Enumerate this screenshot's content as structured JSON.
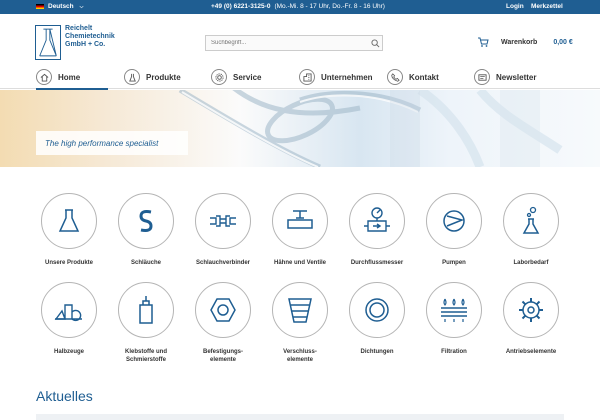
{
  "topbar": {
    "language": "Deutsch",
    "phone": "+49 (0) 6221-3125-0",
    "hours": "(Mo.-Mi. 8 - 17 Uhr, Do.-Fr. 8 - 16 Uhr)",
    "login": "Login",
    "memo": "Merkzettel"
  },
  "logo": {
    "line1": "Reichelt",
    "line2": "Chemietechnik",
    "line3": "GmbH + Co."
  },
  "search": {
    "placeholder": "Suchbegriff..."
  },
  "cart": {
    "label": "Warenkorb",
    "total": "0,00 €"
  },
  "nav": {
    "home": "Home",
    "products": "Produkte",
    "service": "Service",
    "company": "Unternehmen",
    "contact": "Kontakt",
    "newsletter": "Newsletter"
  },
  "hero": {
    "tagline": "The high performance specialist"
  },
  "categories": [
    {
      "label": "Unsere Produkte"
    },
    {
      "label": "Schläuche"
    },
    {
      "label": "Schlauchverbinder"
    },
    {
      "label": "Hähne und Ventile"
    },
    {
      "label": "Durchflussmesser"
    },
    {
      "label": "Pumpen"
    },
    {
      "label": "Laborbedarf"
    },
    {
      "label": "Halbzeuge"
    },
    {
      "line1": "Klebstoffe und",
      "line2": "Schmierstoffe"
    },
    {
      "line1": "Befestigungs-",
      "line2": "elemente"
    },
    {
      "line1": "Verschluss-",
      "line2": "elemente"
    },
    {
      "label": "Dichtungen"
    },
    {
      "label": "Filtration"
    },
    {
      "label": "Antriebselemente"
    }
  ],
  "section": {
    "title": "Aktuelles"
  },
  "colors": {
    "brand": "#1f5e92",
    "topbar": "#1f5e92"
  }
}
